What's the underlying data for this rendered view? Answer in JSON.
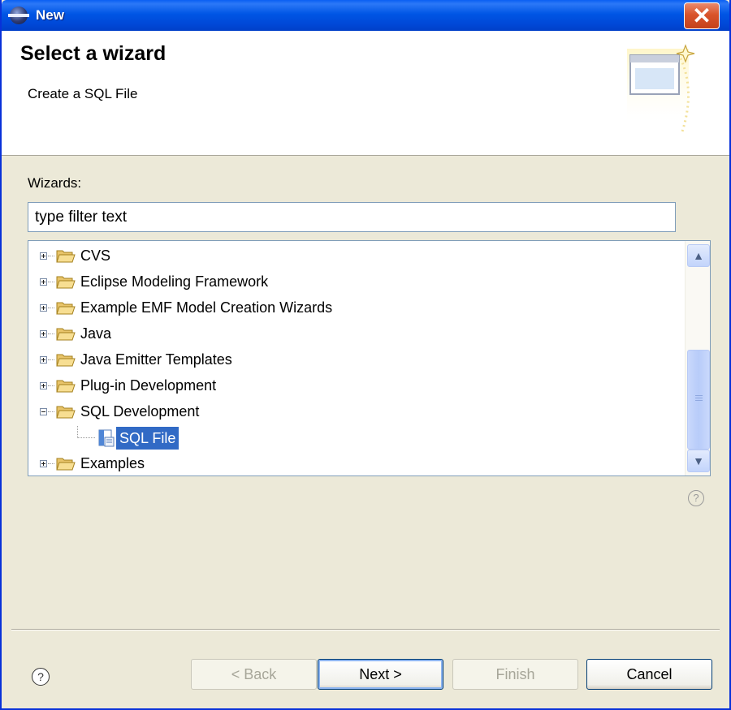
{
  "window": {
    "title": "New",
    "close_glyph": "✕"
  },
  "header": {
    "title": "Select a wizard",
    "description": "Create a SQL File",
    "icon": "wizard-banner-icon"
  },
  "filter": {
    "label": "Wizards:",
    "value": "type filter text"
  },
  "tree": {
    "items": [
      {
        "label": "CVS",
        "expander": "plus",
        "icon": "folder-icon"
      },
      {
        "label": "Eclipse Modeling Framework",
        "expander": "plus",
        "icon": "folder-icon"
      },
      {
        "label": "Example EMF Model Creation Wizards",
        "expander": "plus",
        "icon": "folder-icon"
      },
      {
        "label": "Java",
        "expander": "plus",
        "icon": "folder-icon"
      },
      {
        "label": "Java Emitter Templates",
        "expander": "plus",
        "icon": "folder-icon"
      },
      {
        "label": "Plug-in Development",
        "expander": "plus",
        "icon": "folder-icon"
      },
      {
        "label": "SQL Development",
        "expander": "minus",
        "icon": "folder-icon"
      },
      {
        "label": "SQL File",
        "child": true,
        "selected": true,
        "icon": "sql-file-icon"
      },
      {
        "label": "Examples",
        "expander": "plus",
        "icon": "folder-icon"
      }
    ]
  },
  "scrollbar": {
    "up_glyph": "▲",
    "down_glyph": "▼"
  },
  "help": {
    "glyph": "?"
  },
  "buttons": {
    "back": "< Back",
    "next": "Next >",
    "finish": "Finish",
    "cancel": "Cancel"
  },
  "colors": {
    "selection": "#316AC5",
    "titlebar": "#0054E3",
    "dialog_bg": "#ECE9D8"
  }
}
